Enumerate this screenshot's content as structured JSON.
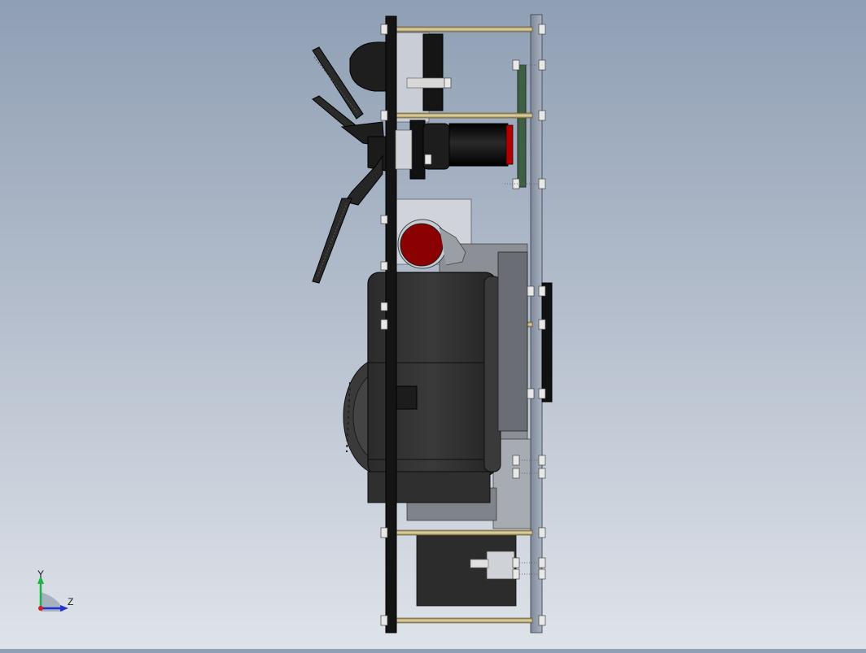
{
  "view": {
    "background_top": "#8f9fb4",
    "background_bottom": "#dfe3e9"
  },
  "triad": {
    "y_label": "Y",
    "z_label": "Z",
    "y_color": "#22b04a",
    "z_color": "#2233cc",
    "x_color": "#cc2222"
  },
  "colors": {
    "plate_dark": "#111111",
    "acrylic": "#8a95a5",
    "brass": "#c8b57a",
    "red": "#8b0000",
    "black_part": "#1a1a1a"
  }
}
